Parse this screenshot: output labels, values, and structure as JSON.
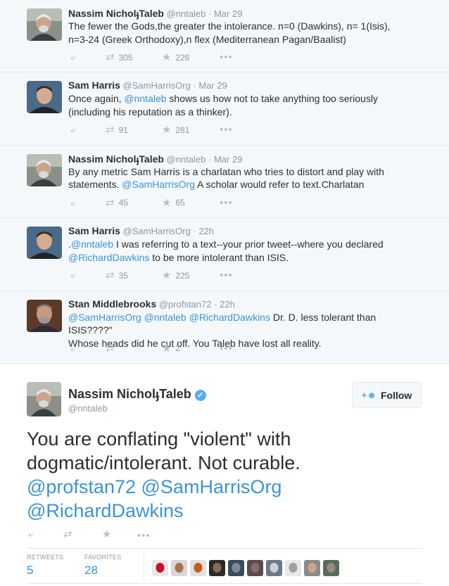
{
  "replies": [
    {
      "name": "Nassim NicholֈTaleb",
      "handle": "@nntaleb",
      "time": "Mar 29",
      "text_lines": [
        [
          {
            "t": "The fewer the Gods,the greater the intolerance. n=0 (Dawkins), n= 1(Isis),",
            "link": false
          }
        ],
        [
          {
            "t": "n=3-24 (Greek Orthodoxy),n flex (Mediterranean Pagan/Baalist)",
            "link": false
          }
        ]
      ],
      "retweets": "305",
      "favorites": "226"
    },
    {
      "name": "Sam Harris",
      "handle": "@SamHarrisOrg",
      "time": "Mar 29",
      "text_lines": [
        [
          {
            "t": "Once again, ",
            "link": false
          },
          {
            "t": "@nntaleb",
            "link": true
          },
          {
            "t": " shows us how not to take anything too seriously",
            "link": false
          }
        ],
        [
          {
            "t": "(including his reputation as a thinker).",
            "link": false
          }
        ]
      ],
      "retweets": "91",
      "favorites": "281"
    },
    {
      "name": "Nassim NicholֈTaleb",
      "handle": "@nntaleb",
      "time": "Mar 29",
      "text_lines": [
        [
          {
            "t": "By any metric Sam Harris is a charlatan who tries to distort and play with",
            "link": false
          }
        ],
        [
          {
            "t": "statements. ",
            "link": false
          },
          {
            "t": "@SamHarrisOrg",
            "link": true
          },
          {
            "t": " A scholar would refer to text.Charlatan",
            "link": false
          }
        ]
      ],
      "retweets": "45",
      "favorites": "65"
    },
    {
      "name": "Sam Harris",
      "handle": "@SamHarrisOrg",
      "time": "22h",
      "text_lines": [
        [
          {
            "t": ".",
            "link": false
          },
          {
            "t": "@nntaleb",
            "link": true
          },
          {
            "t": " I was referring to a text--your prior tweet--where you declared",
            "link": false
          }
        ],
        [
          {
            "t": "@RichardDawkins",
            "link": true
          },
          {
            "t": " to be more intolerant than ISIS.",
            "link": false
          }
        ]
      ],
      "retweets": "35",
      "favorites": "225"
    },
    {
      "name": "Stan Middlebrooks",
      "handle": "@profstan72",
      "time": "22h",
      "text_lines": [
        [
          {
            "t": "@SamHarrisOrg",
            "link": true
          },
          {
            "t": " ",
            "link": false
          },
          {
            "t": "@nntaleb",
            "link": true
          },
          {
            "t": " ",
            "link": false
          },
          {
            "t": "@RichardDawkins",
            "link": true
          },
          {
            "t": " Dr. D. less tolerant than ISIS????\"",
            "link": false
          }
        ],
        [
          {
            "t": "Whose heads did he cut off.  You Taleb have lost all reality.",
            "link": false
          }
        ]
      ],
      "retweets": "",
      "favorites": "2"
    }
  ],
  "main_tweet": {
    "name": "Nassim NicholֈTaleb",
    "handle": "@nntaleb",
    "follow_label": "Follow",
    "text_plain_1": "You are conflating \"violent\" with",
    "text_plain_2": "dogmatic/intolerant. Not curable.",
    "mention_1": "@profstan72",
    "mention_2": "@SamHarrisOrg",
    "mention_3": "@RichardDawkins",
    "retweets_label": "RETWEETS",
    "retweets": "5",
    "favorites_label": "FAVORITES",
    "favorites": "28"
  },
  "icons": {
    "reply": "reply-icon",
    "retweet": "retweet-icon",
    "favorite": "star-icon",
    "more": "more-icon",
    "follow": "add-user-icon",
    "verified": "verified-badge-icon"
  },
  "colors": {
    "link": "#3b94d9",
    "thread_bg": "#f5f8fa",
    "muted": "#8899a6",
    "verified": "#55acee"
  },
  "favoriters_count": 10
}
